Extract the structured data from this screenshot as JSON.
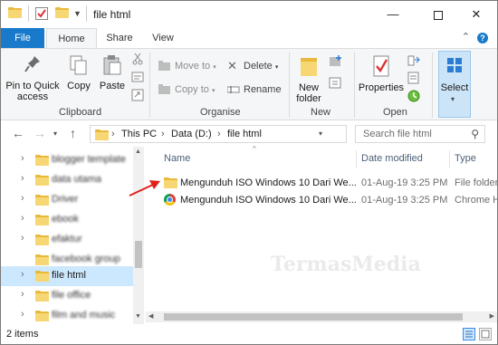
{
  "window": {
    "title": "file html"
  },
  "ribbon_tabs": {
    "file": "File",
    "home": "Home",
    "share": "Share",
    "view": "View"
  },
  "ribbon": {
    "clipboard": {
      "pin": "Pin to Quick access",
      "copy": "Copy",
      "paste": "Paste",
      "label": "Clipboard"
    },
    "organise": {
      "move_to": "Move to",
      "copy_to": "Copy to",
      "delete": "Delete",
      "rename": "Rename",
      "label": "Organise"
    },
    "new": {
      "new_folder": "New folder",
      "label": "New"
    },
    "open": {
      "properties": "Properties",
      "label": "Open"
    },
    "select": {
      "select": "Select"
    }
  },
  "address": {
    "crumbs": [
      "This PC",
      "Data (D:)",
      "file html"
    ],
    "search_placeholder": "Search file html"
  },
  "nav_pane": {
    "items": [
      {
        "label": "blogger template"
      },
      {
        "label": "data utama"
      },
      {
        "label": "Driver"
      },
      {
        "label": "ebook"
      },
      {
        "label": "efaktur"
      },
      {
        "label": "facebook group"
      },
      {
        "label": "file html"
      },
      {
        "label": "file office"
      },
      {
        "label": "film and music"
      }
    ]
  },
  "columns": {
    "name": "Name",
    "date_modified": "Date modified",
    "type": "Type"
  },
  "files": [
    {
      "name": "Mengunduh ISO Windows 10 Dari We...",
      "date": "01-Aug-19 3:25 PM",
      "type": "File folder",
      "icon": "folder-icon"
    },
    {
      "name": "Mengunduh ISO Windows 10 Dari We...",
      "date": "01-Aug-19 3:25 PM",
      "type": "Chrome H",
      "icon": "chrome-icon"
    }
  ],
  "status": {
    "items": "2 items"
  },
  "watermark": "TermasMedia",
  "colors": {
    "accent": "#1979ca",
    "selection": "#cce8ff",
    "arrow": "#e0201b"
  }
}
